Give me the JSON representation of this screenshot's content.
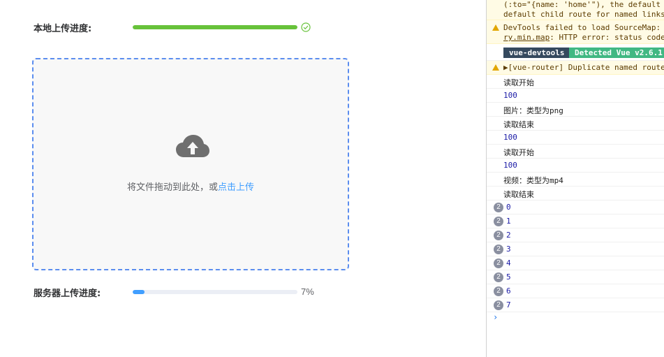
{
  "app": {
    "local_upload": {
      "label": "本地上传进度:",
      "progress": 1.0,
      "status": "success",
      "bar_color": "#67c23a"
    },
    "dropzone": {
      "text": "将文件拖动到此处，或",
      "link_text": "点击上传",
      "icon": "upload-cloud-icon",
      "border_color": "#5b8def"
    },
    "server_upload": {
      "label": "服务器上传进度:",
      "progress": 0.07,
      "percent_text": "7%",
      "bar_color": "#409eff"
    }
  },
  "console": {
    "lines": [
      {
        "type": "warn-cont",
        "text": "(:to=\"{name: 'home'\"), the default"
      },
      {
        "type": "warn-cont",
        "text": "default child route for named links"
      },
      {
        "type": "warn",
        "text": "DevTools failed to load SourceMap:",
        "text2": "ry.min.map",
        "text3": ": HTTP error: status code"
      },
      {
        "type": "vue",
        "badge1": "vue-devtools",
        "badge2": "Detected Vue v2.6.1"
      },
      {
        "type": "warn",
        "text": "▶[vue-router] Duplicate named route"
      },
      {
        "type": "log",
        "text": "读取开始"
      },
      {
        "type": "num",
        "text": "100"
      },
      {
        "type": "log",
        "text": "图片：类型为png"
      },
      {
        "type": "log",
        "text": "读取结束"
      },
      {
        "type": "num",
        "text": "100"
      },
      {
        "type": "log",
        "text": "读取开始"
      },
      {
        "type": "num",
        "text": "100"
      },
      {
        "type": "log",
        "text": "视频：类型为mp4"
      },
      {
        "type": "log",
        "text": "读取结束"
      },
      {
        "type": "counted",
        "count": "2",
        "text": "0"
      },
      {
        "type": "counted",
        "count": "2",
        "text": "1"
      },
      {
        "type": "counted",
        "count": "2",
        "text": "2"
      },
      {
        "type": "counted",
        "count": "2",
        "text": "3"
      },
      {
        "type": "counted",
        "count": "2",
        "text": "4"
      },
      {
        "type": "counted",
        "count": "2",
        "text": "5"
      },
      {
        "type": "counted",
        "count": "2",
        "text": "6"
      },
      {
        "type": "counted",
        "count": "2",
        "text": "7"
      }
    ],
    "prompt": "›"
  }
}
